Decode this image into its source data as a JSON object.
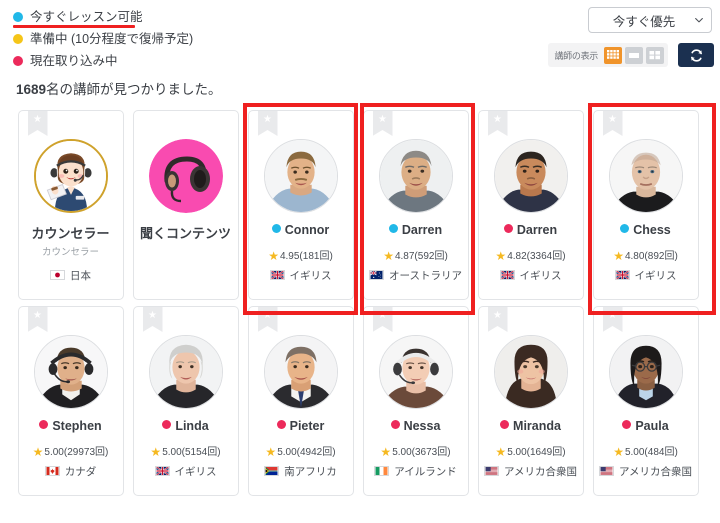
{
  "legend": {
    "items": [
      {
        "label": "今すぐレッスン可能",
        "color": "#21b8e8",
        "underlined": true
      },
      {
        "label": "準備中 (10分程度で復帰予定)",
        "color": "#f5c518",
        "underlined": false
      },
      {
        "label": "現在取り込み中",
        "color": "#ec2a5b",
        "underlined": false
      }
    ]
  },
  "controls": {
    "sort_value": "今すぐ優先",
    "sort_options": [
      "今すぐ優先"
    ],
    "view_label": "講師の表示",
    "view_buttons": [
      {
        "name": "compact-grid",
        "active": true
      },
      {
        "name": "list-view",
        "active": false
      },
      {
        "name": "large-grid",
        "active": false
      }
    ],
    "refresh_label": "更新"
  },
  "result_count": {
    "number": "1689",
    "suffix": "名の講師が見つかりました。"
  },
  "cards": [
    {
      "type": "counselor",
      "name": "カウンセラー",
      "subtitle": "カウンセラー",
      "country": "日本",
      "flag": "jp",
      "status": null,
      "rating": null,
      "ribbon": true,
      "highlighted": false,
      "avatar": "counselor-illustration"
    },
    {
      "type": "content",
      "name": "聞くコンテンツ",
      "subtitle": null,
      "country": null,
      "flag": null,
      "status": null,
      "rating": null,
      "ribbon": false,
      "highlighted": false,
      "avatar": "headphones-pink"
    },
    {
      "type": "tutor",
      "name": "Connor",
      "subtitle": null,
      "country": "イギリス",
      "flag": "gb",
      "status": "available",
      "status_color": "#21b8e8",
      "rating": "4.95(181回)",
      "ribbon": true,
      "highlighted": true,
      "avatar": "photo-connor"
    },
    {
      "type": "tutor",
      "name": "Darren",
      "subtitle": null,
      "country": "オーストラリア",
      "flag": "au",
      "status": "available",
      "status_color": "#21b8e8",
      "rating": "4.87(592回)",
      "ribbon": true,
      "highlighted": true,
      "avatar": "photo-darren-au"
    },
    {
      "type": "tutor",
      "name": "Darren",
      "subtitle": null,
      "country": "イギリス",
      "flag": "gb",
      "status": "busy",
      "status_color": "#ec2a5b",
      "rating": "4.82(3364回)",
      "ribbon": true,
      "highlighted": false,
      "avatar": "photo-darren-gb"
    },
    {
      "type": "tutor",
      "name": "Chess",
      "subtitle": null,
      "country": "イギリス",
      "flag": "gb",
      "status": "available",
      "status_color": "#21b8e8",
      "rating": "4.80(892回)",
      "ribbon": true,
      "highlighted": true,
      "avatar": "photo-chess"
    },
    {
      "type": "tutor",
      "name": "Stephen",
      "subtitle": null,
      "country": "カナダ",
      "flag": "ca",
      "status": "busy",
      "status_color": "#ec2a5b",
      "rating": "5.00(29973回)",
      "ribbon": true,
      "highlighted": false,
      "avatar": "photo-stephen"
    },
    {
      "type": "tutor",
      "name": "Linda",
      "subtitle": null,
      "country": "イギリス",
      "flag": "gb",
      "status": "busy",
      "status_color": "#ec2a5b",
      "rating": "5.00(5154回)",
      "ribbon": true,
      "highlighted": false,
      "avatar": "photo-linda"
    },
    {
      "type": "tutor",
      "name": "Pieter",
      "subtitle": null,
      "country": "南アフリカ",
      "flag": "za",
      "status": "busy",
      "status_color": "#ec2a5b",
      "rating": "5.00(4942回)",
      "ribbon": true,
      "highlighted": false,
      "avatar": "photo-pieter"
    },
    {
      "type": "tutor",
      "name": "Nessa",
      "subtitle": null,
      "country": "アイルランド",
      "flag": "ie",
      "status": "busy",
      "status_color": "#ec2a5b",
      "rating": "5.00(3673回)",
      "ribbon": true,
      "highlighted": false,
      "avatar": "photo-nessa"
    },
    {
      "type": "tutor",
      "name": "Miranda",
      "subtitle": null,
      "country": "アメリカ合衆国",
      "flag": "us",
      "status": "busy",
      "status_color": "#ec2a5b",
      "rating": "5.00(1649回)",
      "ribbon": true,
      "highlighted": false,
      "avatar": "photo-miranda"
    },
    {
      "type": "tutor",
      "name": "Paula",
      "subtitle": null,
      "country": "アメリカ合衆国",
      "flag": "us",
      "status": "busy",
      "status_color": "#ec2a5b",
      "rating": "5.00(484回)",
      "ribbon": true,
      "highlighted": false,
      "avatar": "photo-paula"
    }
  ]
}
